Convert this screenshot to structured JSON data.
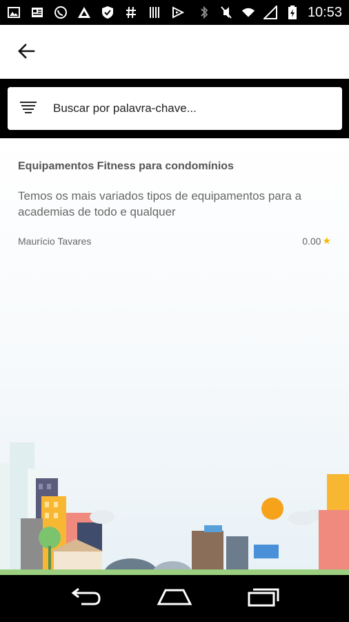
{
  "status_bar": {
    "time": "10:53",
    "icons": [
      "image-icon",
      "news-icon",
      "whatsapp-icon",
      "triangle-app-icon",
      "shield-check-icon",
      "hashtag-icon",
      "barcode-icon",
      "feedly-icon",
      "bluetooth-icon",
      "mute-icon",
      "wifi-icon",
      "signal-icon",
      "battery-charging-icon"
    ]
  },
  "app_bar": {
    "back_icon": "arrow-left-icon"
  },
  "search": {
    "placeholder": "Buscar por palavra-chave...",
    "filter_icon": "filter-list-icon"
  },
  "results": [
    {
      "title": "Equipamentos Fitness para condomínios",
      "description": "Temos os mais variados tipos de equipamentos para a academias de todo e qualquer",
      "author": "Maurício Tavares",
      "rating": "0.00",
      "rating_icon": "star-icon"
    }
  ],
  "nav_bar": {
    "icons": [
      "back-nav-icon",
      "home-nav-icon",
      "recents-nav-icon"
    ]
  },
  "colors": {
    "star": "#f5b800",
    "sun": "#f7a21b",
    "background": "#ffffff"
  }
}
